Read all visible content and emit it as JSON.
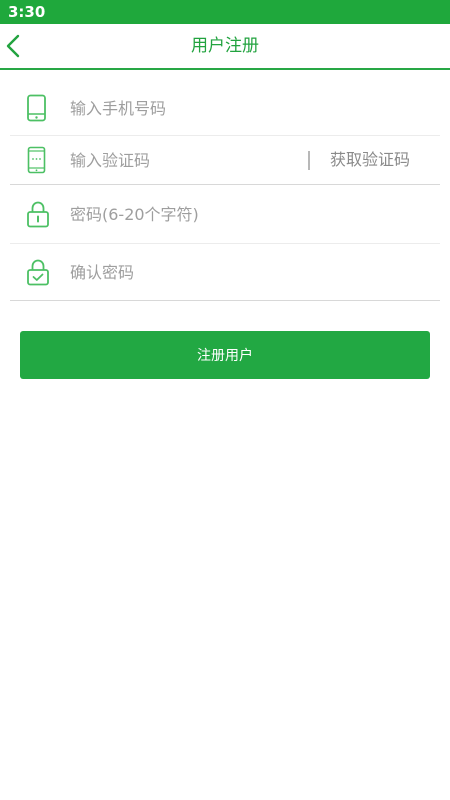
{
  "status_bar": {
    "time": "3:30"
  },
  "header": {
    "title": "用户注册",
    "back_icon": "chevron-left-icon"
  },
  "form": {
    "phone": {
      "placeholder": "输入手机号码",
      "value": "",
      "icon": "phone-icon"
    },
    "code": {
      "placeholder": "输入验证码",
      "value": "",
      "icon": "phone-sms-icon",
      "get_code_label": "获取验证码"
    },
    "password": {
      "placeholder": "密码(6-20个字符)",
      "value": "",
      "icon": "lock-icon"
    },
    "confirm": {
      "placeholder": "确认密码",
      "value": "",
      "icon": "lock-check-icon"
    }
  },
  "register_button": {
    "label": "注册用户"
  },
  "colors": {
    "accent": "#22a843",
    "status_bar": "#1fa83c",
    "icon": "#4cc064"
  }
}
